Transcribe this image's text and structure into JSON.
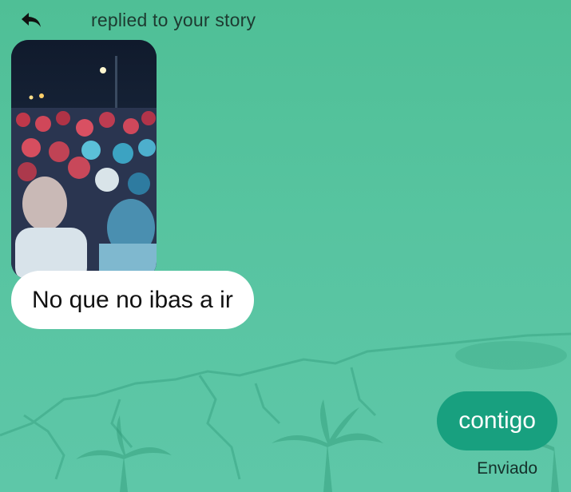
{
  "header": {
    "icon": "reply-icon",
    "text": "replied to your story"
  },
  "story": {
    "description_icon": "story-photo"
  },
  "messages": [
    {
      "direction": "received",
      "text": "No que no ibas a ir"
    },
    {
      "direction": "sent",
      "text": "contigo"
    }
  ],
  "status": "Enviado",
  "colors": {
    "background": "#57c4a0",
    "incoming_bubble": "#ffffff",
    "outgoing_bubble": "#18a07f"
  }
}
